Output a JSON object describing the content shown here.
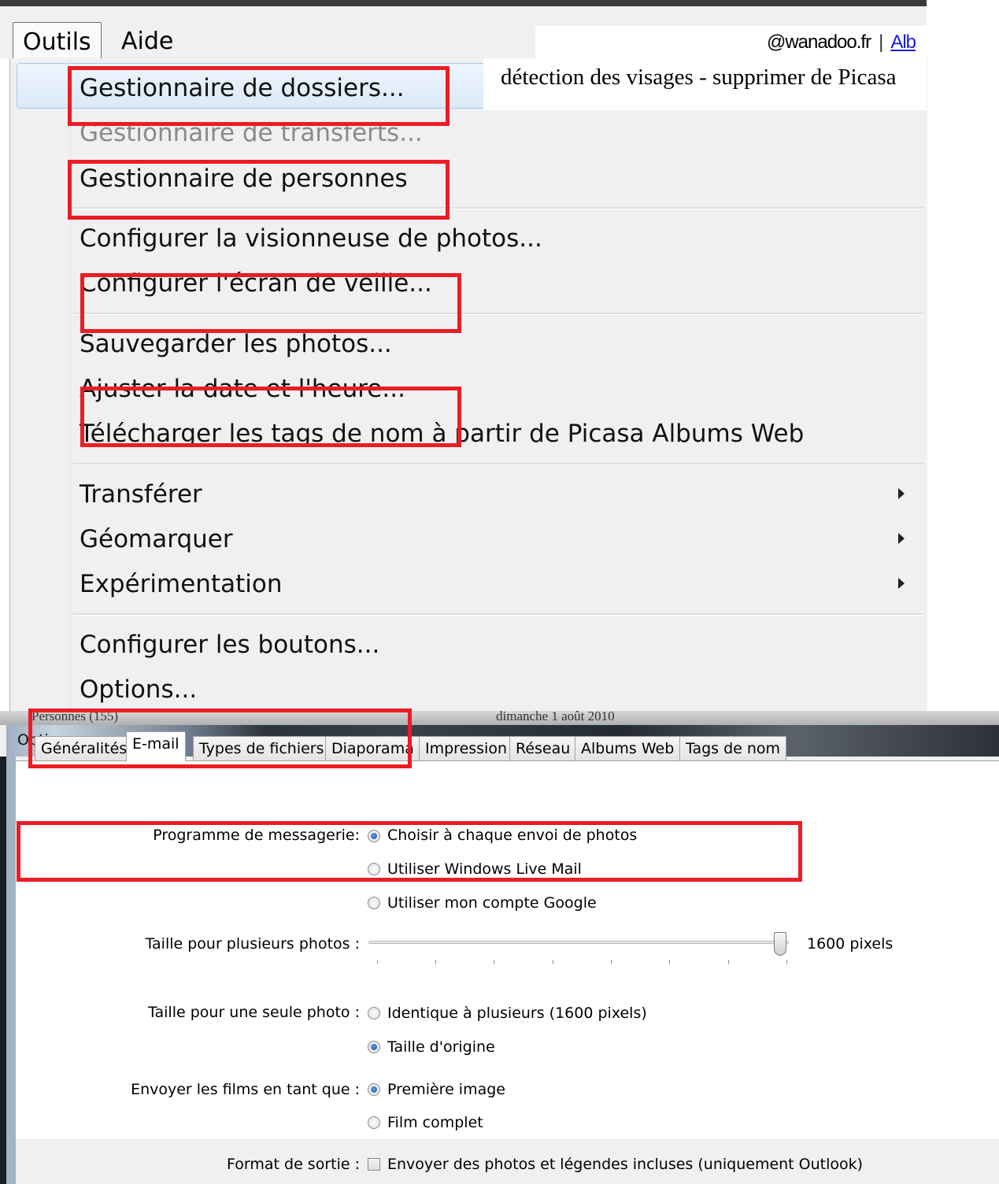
{
  "menubar": {
    "items": [
      {
        "label": "Outils",
        "active": true
      },
      {
        "label": "Aide",
        "active": false
      }
    ],
    "account": {
      "email_fragment": "@wanadoo.fr",
      "separator": "|",
      "link_fragment": "Alb"
    }
  },
  "annotation": {
    "text": "détection des visages - supprimer de Picasa"
  },
  "tools_menu": {
    "items": [
      {
        "label": "Gestionnaire de dossiers...",
        "highlighted": true
      },
      {
        "label": "Gestionnaire de transferts...",
        "disabled": true
      },
      {
        "label": "Gestionnaire de personnes"
      },
      {
        "label": "Configurer la visionneuse de photos..."
      },
      {
        "label": "Configurer l'écran de veille..."
      },
      {
        "label": "Sauvegarder les photos..."
      },
      {
        "label": "Ajuster la date et l'heure..."
      },
      {
        "label": "Télécharger les tags de nom à partir de Picasa Albums Web"
      },
      {
        "label": "Transférer",
        "submenu": true
      },
      {
        "label": "Géomarquer",
        "submenu": true
      },
      {
        "label": "Expérimentation",
        "submenu": true
      },
      {
        "label": "Configurer les boutons..."
      },
      {
        "label": "Options..."
      }
    ]
  },
  "background_strip": {
    "left_text": "Personnes (155)",
    "right_text": "dimanche 1 août 2010"
  },
  "dialog": {
    "title": "Options",
    "tabs": [
      {
        "label": "Généralités",
        "active": false
      },
      {
        "label": "E-mail",
        "active": true
      },
      {
        "label": "Types de fichiers",
        "active": false
      },
      {
        "label": "Diaporama",
        "active": false
      },
      {
        "label": "Impression",
        "active": false
      },
      {
        "label": "Réseau",
        "active": false
      },
      {
        "label": "Albums Web",
        "active": false
      },
      {
        "label": "Tags de nom",
        "active": false
      }
    ],
    "email_program": {
      "label": "Programme de messagerie:",
      "options": [
        {
          "label": "Choisir à chaque envoi de photos",
          "selected": true
        },
        {
          "label": "Utiliser Windows Live Mail",
          "selected": false
        },
        {
          "label": "Utiliser mon compte Google",
          "selected": false
        }
      ]
    },
    "multi_size": {
      "label": "Taille pour plusieurs photos :",
      "value_label": "1600 pixels",
      "slider_fraction": 1.0
    },
    "single_size": {
      "label": "Taille pour une seule photo :",
      "options": [
        {
          "label": "Identique à plusieurs (1600 pixels)",
          "selected": false
        },
        {
          "label": "Taille d'origine",
          "selected": true
        }
      ]
    },
    "movies": {
      "label": "Envoyer les films en tant que :",
      "options": [
        {
          "label": "Première image",
          "selected": true
        },
        {
          "label": "Film complet",
          "selected": false
        }
      ]
    },
    "output_format": {
      "label": "Format de sortie :",
      "checkbox_label": "Envoyer des photos et légendes incluses (uniquement Outlook)",
      "checked": false
    }
  },
  "colors": {
    "annotation_red": "#ec1c24",
    "link_blue": "#1a1ae6",
    "menu_bg": "#f0f0f0"
  }
}
